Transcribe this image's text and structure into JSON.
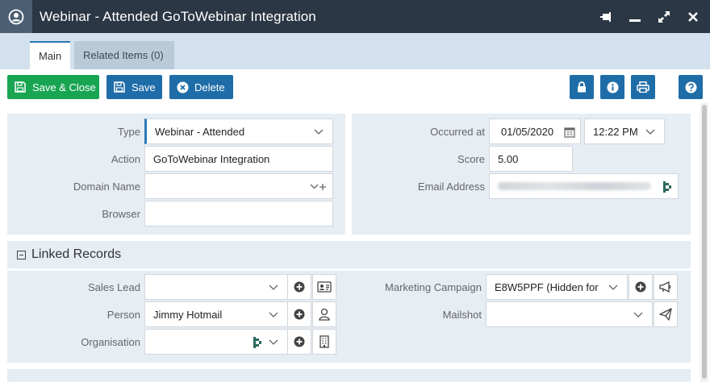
{
  "window": {
    "title": "Webinar - Attended GoToWebinar Integration",
    "controls": [
      "pin-icon",
      "minimize-icon",
      "expand-icon",
      "close-icon"
    ]
  },
  "tabs": [
    {
      "label": "Main",
      "active": true
    },
    {
      "label": "Related Items (0)",
      "active": false
    }
  ],
  "toolbar": {
    "save_close_label": "Save & Close",
    "save_label": "Save",
    "delete_label": "Delete",
    "right_icons": [
      "lock-icon",
      "info-icon",
      "print-icon",
      "help-icon"
    ]
  },
  "details": {
    "type_label": "Type",
    "type_value": "Webinar - Attended",
    "action_label": "Action",
    "action_value": "GoToWebinar Integration",
    "domain_label": "Domain Name",
    "domain_value": "",
    "browser_label": "Browser",
    "browser_value": "",
    "occurred_label": "Occurred at",
    "occurred_date": "01/05/2020",
    "occurred_time": "12:22 PM",
    "score_label": "Score",
    "score_value": "5.00",
    "email_label": "Email Address"
  },
  "linked": {
    "header": "Linked Records",
    "sales_lead_label": "Sales Lead",
    "sales_lead_value": "",
    "person_label": "Person",
    "person_value": "Jimmy Hotmail",
    "organisation_label": "Organisation",
    "organisation_value": "",
    "campaign_label": "Marketing Campaign",
    "campaign_value": "E8W5PPF (Hidden for",
    "mailshot_label": "Mailshot",
    "mailshot_value": ""
  },
  "colors": {
    "titlebar": "#2b3744",
    "accent_blue": "#1f6da8",
    "save_green": "#18a552",
    "panel_bg": "#e6edf3"
  }
}
